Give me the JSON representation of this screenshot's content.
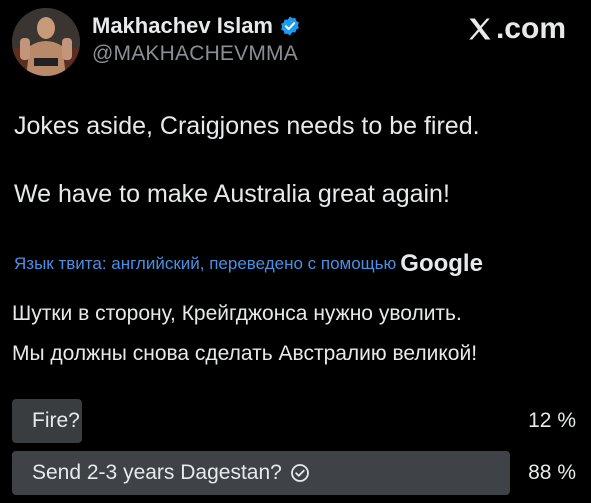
{
  "author": {
    "display_name": "Makhachev Islam",
    "handle": "@MAKHACHEVMMA",
    "verified_color": "#1d9bf0"
  },
  "brand": {
    "icon": "x-logo-icon",
    "label": ".com"
  },
  "tweet": {
    "line1": "Jokes aside, Craigjones needs to be fired.",
    "line2": "We have to make Australia great again!"
  },
  "translation": {
    "label": "Язык твита: английский, переведено с помощью",
    "provider": "Google",
    "line1": "Шутки в сторону, Крейгджонса нужно уволить.",
    "line2": "Мы должны снова сделать Австралию великой!"
  },
  "poll": {
    "options": [
      {
        "label": "Fire?",
        "percent_text": "12 %",
        "fraction": 0.12,
        "selected": false
      },
      {
        "label": "Send 2-3 years Dagestan?",
        "percent_text": "88 %",
        "fraction": 0.88,
        "selected": true
      }
    ]
  },
  "colors": {
    "background": "#000000",
    "text": "#e7e9ea",
    "muted": "#8b8f94",
    "link": "#4a90e2",
    "poll_bar": "#3a3d40"
  }
}
